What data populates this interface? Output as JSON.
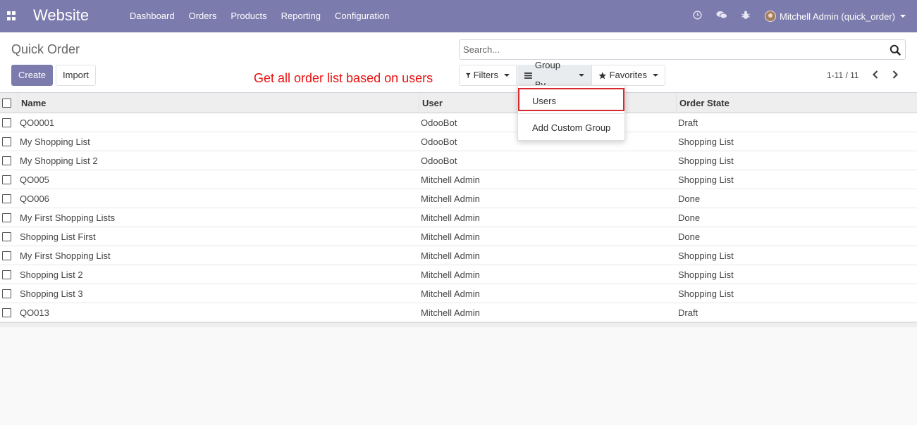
{
  "navbar": {
    "brand": "Website",
    "menu": [
      "Dashboard",
      "Orders",
      "Products",
      "Reporting",
      "Configuration"
    ],
    "user": "Mitchell Admin (quick_order)",
    "colors": {
      "navbar": "#7c7bad"
    }
  },
  "control_panel": {
    "breadcrumb": "Quick Order",
    "create_label": "Create",
    "import_label": "Import",
    "annotation": "Get all order list based on users",
    "search_placeholder": "Search...",
    "filters_label": "Filters",
    "groupby_label": "Group By",
    "favorites_label": "Favorites",
    "pager": "1-11 / 11"
  },
  "dropdown": {
    "items": [
      "Users",
      "Add Custom Group"
    ]
  },
  "table": {
    "columns": [
      "Name",
      "User",
      "Order State"
    ],
    "rows": [
      [
        "QO0001",
        "OdooBot",
        "Draft"
      ],
      [
        "My Shopping List",
        "OdooBot",
        "Shopping List"
      ],
      [
        "My Shopping List 2",
        "OdooBot",
        "Shopping List"
      ],
      [
        "QO005",
        "Mitchell Admin",
        "Shopping List"
      ],
      [
        "QO006",
        "Mitchell Admin",
        "Done"
      ],
      [
        "My First Shopping Lists",
        "Mitchell Admin",
        "Done"
      ],
      [
        "Shopping List First",
        "Mitchell Admin",
        "Done"
      ],
      [
        "My First Shopping List",
        "Mitchell Admin",
        "Shopping List"
      ],
      [
        "Shopping List 2",
        "Mitchell Admin",
        "Shopping List"
      ],
      [
        "Shopping List 3",
        "Mitchell Admin",
        "Shopping List"
      ],
      [
        "QO013",
        "Mitchell Admin",
        "Draft"
      ]
    ]
  }
}
